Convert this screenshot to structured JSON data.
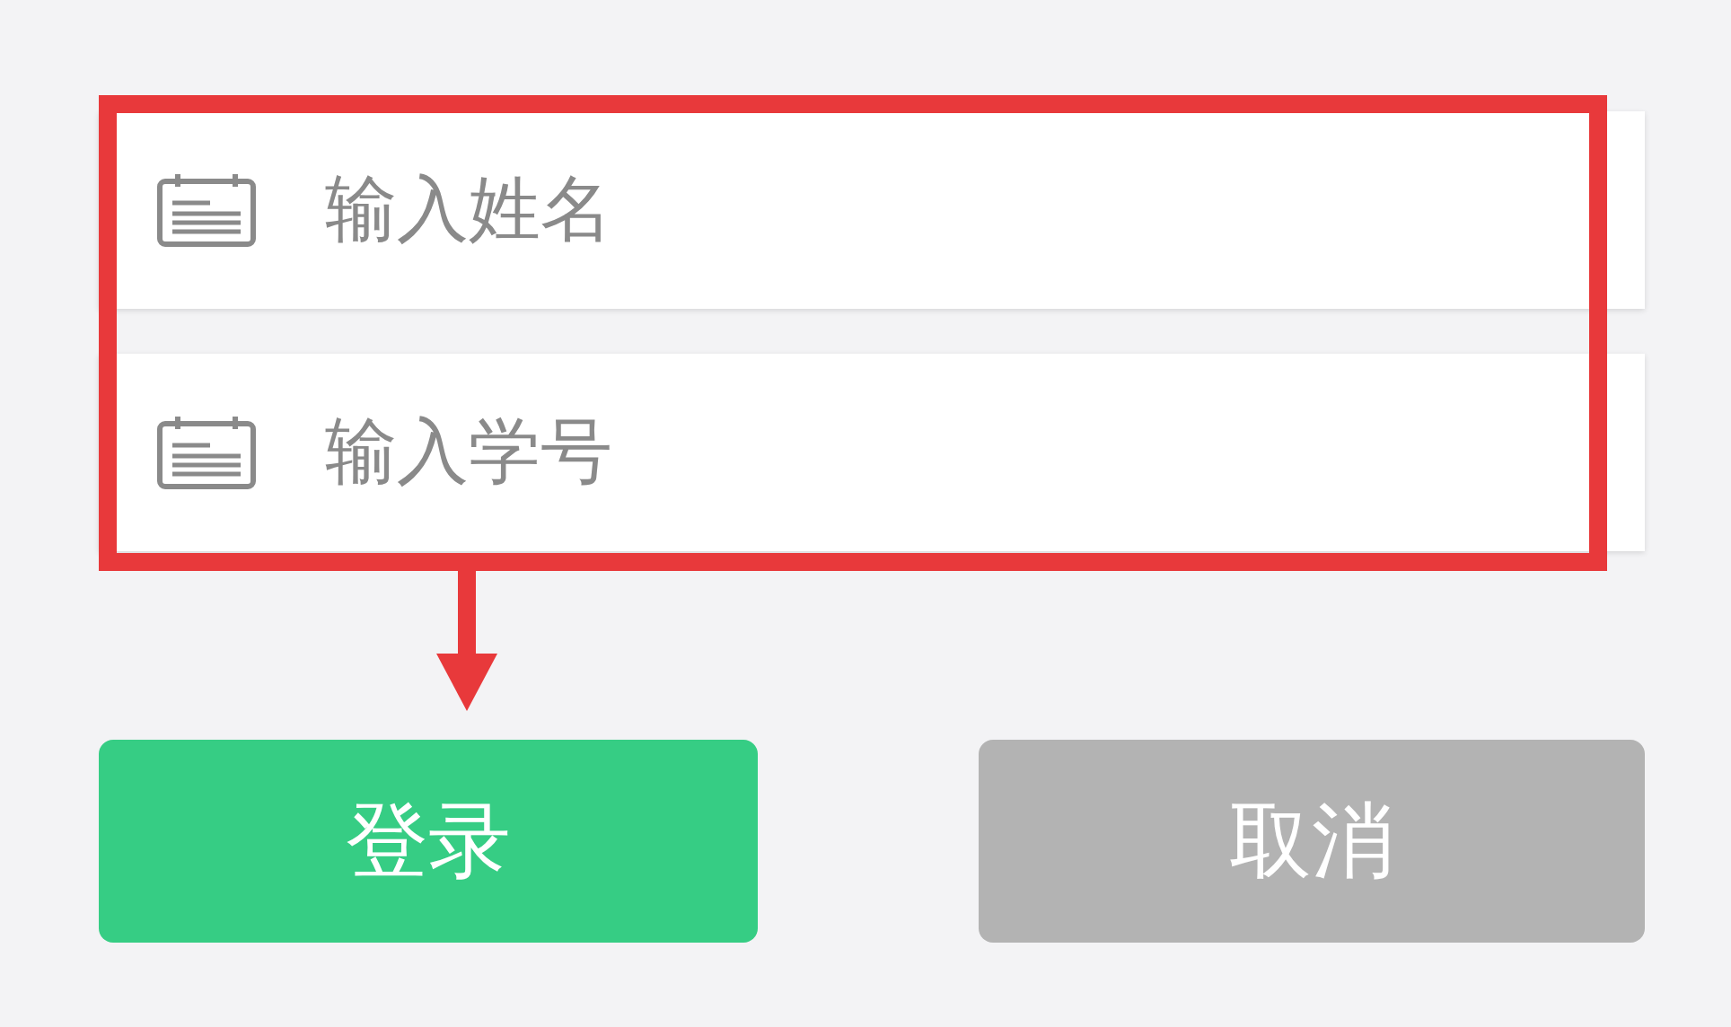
{
  "fields": [
    {
      "placeholder": "输入姓名"
    },
    {
      "placeholder": "输入学号"
    }
  ],
  "buttons": [
    {
      "label": "登录",
      "kind": "primary"
    },
    {
      "label": "取消",
      "kind": "secondary"
    }
  ]
}
